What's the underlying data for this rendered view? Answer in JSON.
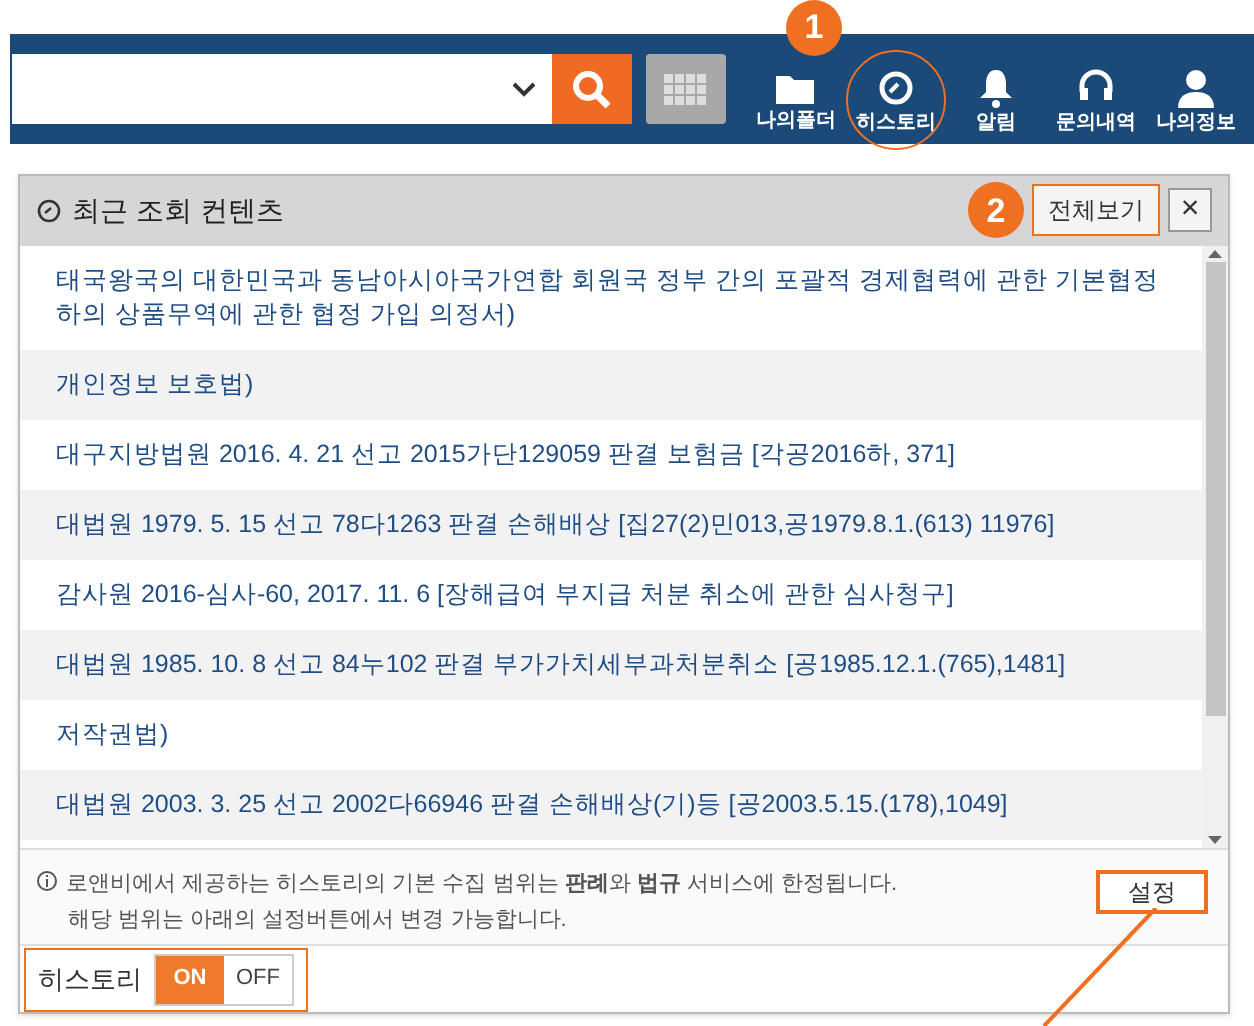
{
  "top_bar": {
    "nav": [
      {
        "kind": "folder",
        "label": "나의폴더",
        "highlighted": false
      },
      {
        "kind": "history",
        "label": "히스토리",
        "highlighted": true
      },
      {
        "kind": "bell",
        "label": "알림",
        "highlighted": false
      },
      {
        "kind": "headset",
        "label": "문의내역",
        "highlighted": false
      },
      {
        "kind": "user",
        "label": "나의정보",
        "highlighted": false
      }
    ]
  },
  "annotations": [
    {
      "label": "1"
    },
    {
      "label": "2"
    }
  ],
  "panel": {
    "title": "최근 조회 컨텐츠",
    "view_all": "전체보기",
    "close": "×",
    "items": [
      {
        "text": "태국왕국의 대한민국과 동남아시아국가연합 회원국 정부 간의 포괄적 경제협력에 관한 기본협정 하의 상품무역에 관한 협정 가입 의정서)"
      },
      {
        "text": "개인정보 보호법)"
      },
      {
        "text": "대구지방법원 2016. 4. 21 선고 2015가단129059 판결 보험금 [각공2016하, 371]"
      },
      {
        "text": "대법원 1979. 5. 15 선고 78다1263 판결 손해배상 [집27(2)민013,공1979.8.1.(613) 11976]"
      },
      {
        "text": "감사원 2016-심사-60, 2017. 11. 6 [장해급여 부지급 처분 취소에 관한 심사청구]"
      },
      {
        "text": "대법원 1985. 10. 8 선고 84누102 판결 부가가치세부과처분취소 [공1985.12.1.(765),1481]"
      },
      {
        "text": "저작권법)"
      },
      {
        "text": "대법원 2003. 3. 25 선고 2002다66946 판결 손해배상(기)등 [공2003.5.15.(178),1049]"
      }
    ],
    "note_lines": [
      "로앤비에서 제공하는 히스토리의 기본 수집 범위는 **판례**와 **법규** 서비스에 한정됩니다.",
      "해당 범위는 아래의 설정버튼에서 변경 가능합니다."
    ],
    "settings_button": "설정",
    "history_toggle": {
      "label": "히스토리",
      "options": [
        {
          "label": "ON",
          "selected": true
        },
        {
          "label": "OFF",
          "selected": false
        }
      ]
    }
  }
}
